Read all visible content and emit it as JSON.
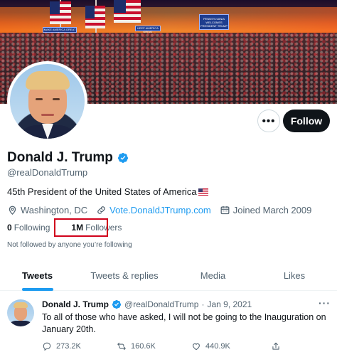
{
  "banner": {
    "sign_main": "PENNSYLVANIA WELCOMES PRESIDENT TRUMP",
    "sign_left": "MAKE AMERICA GREAT AGAIN",
    "sign_mid": "KEEP AMERICA GREAT"
  },
  "profile": {
    "name": "Donald J. Trump",
    "handle": "@realDonaldTrump",
    "bio": "45th President of the United States of America",
    "location": "Washington, DC",
    "website": "Vote.DonaldJTrump.com",
    "joined": "Joined March 2009",
    "following_count": "0",
    "following_label": "Following",
    "followers_count": "1M",
    "followers_label": "Followers",
    "not_followed_note": "Not followed by anyone you’re following",
    "follow_button": "Follow",
    "more_button": "•••"
  },
  "tabs": [
    {
      "label": "Tweets",
      "active": true
    },
    {
      "label": "Tweets & replies",
      "active": false
    },
    {
      "label": "Media",
      "active": false
    },
    {
      "label": "Likes",
      "active": false
    }
  ],
  "tweet": {
    "author": "Donald J. Trump",
    "handle": "@realDonaldTrump",
    "separator": "·",
    "date": "Jan 9, 2021",
    "text": "To all of those who have asked, I will not be going to the Inauguration on January 20th.",
    "more": "···",
    "replies": "273.2K",
    "retweets": "160.6K",
    "likes": "440.9K"
  },
  "icons": {
    "verified": "verified-badge-icon",
    "location": "location-pin-icon",
    "link": "link-icon",
    "calendar": "calendar-icon",
    "reply": "reply-icon",
    "retweet": "retweet-icon",
    "like": "heart-icon",
    "share": "share-icon"
  },
  "colors": {
    "accent": "#1d9bf0",
    "text": "#0f1419",
    "muted": "#536471",
    "highlight_box": "#d0021b"
  }
}
